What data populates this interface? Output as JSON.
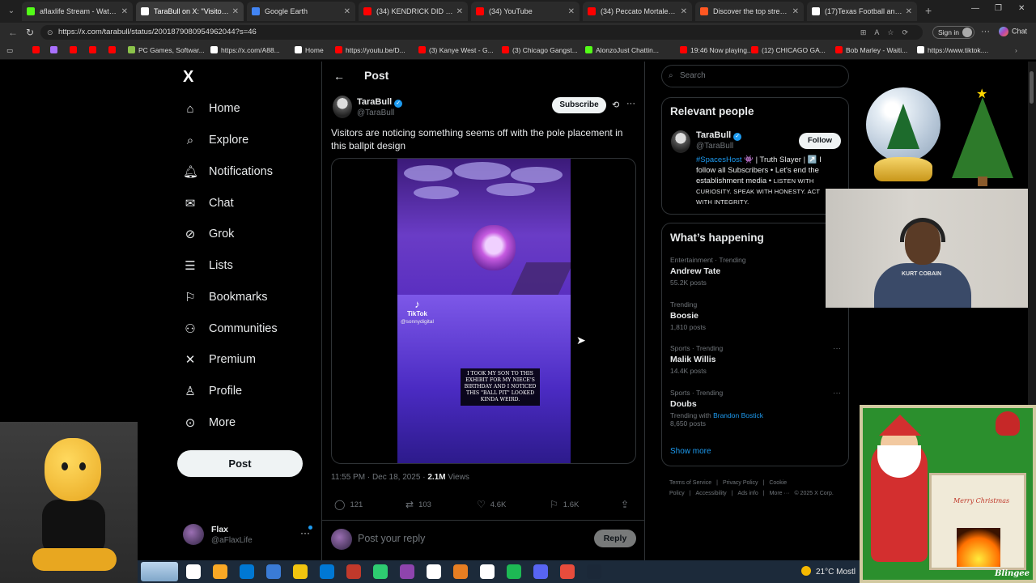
{
  "browser": {
    "tabs": [
      {
        "label": "aflaxlife Stream - Watch Live",
        "favicon_color": "#53fc18"
      },
      {
        "label": "TaraBull on X: \"Visitors are n",
        "favicon_color": "#ffffff"
      },
      {
        "label": "Google Earth",
        "favicon_color": "#4285f4"
      },
      {
        "label": "(34) KENDRICK DID IRREVER",
        "favicon_color": "#ff0000"
      },
      {
        "label": "(34) YouTube",
        "favicon_color": "#ff0000"
      },
      {
        "label": "(34) Peccato Mortale (Happi",
        "favicon_color": "#ff0000"
      },
      {
        "label": "Discover the top streamed m",
        "favicon_color": "#ff5722"
      },
      {
        "label": "(17)Texas Football and Quin",
        "favicon_color": "#ffffff"
      }
    ],
    "url": "https://x.com/tarabull/status/2001879080954962044?s=46",
    "signin_label": "Sign in",
    "chat_label": "Chat",
    "bookmarks": [
      {
        "label": "",
        "color": "#ff0000"
      },
      {
        "label": "",
        "color": "#a970ff"
      },
      {
        "label": "",
        "color": "#ff0000"
      },
      {
        "label": "",
        "color": "#ff0000"
      },
      {
        "label": "",
        "color": "#ff0000"
      },
      {
        "label": "PC Games, Softwar...",
        "color": "#8bc34a"
      },
      {
        "label": "https://x.com/A88...",
        "color": "#ffffff"
      },
      {
        "label": "Home",
        "color": "#ffffff"
      },
      {
        "label": "https://youtu.be/D...",
        "color": "#ff0000"
      },
      {
        "label": "(3) Kanye West - G...",
        "color": "#ff0000"
      },
      {
        "label": "(3) Chicago Gangst...",
        "color": "#ff0000"
      },
      {
        "label": "AlonzoJust Chattin...",
        "color": "#53fc18"
      },
      {
        "label": "19:46 Now playing...",
        "color": "#ff0000"
      },
      {
        "label": "(12) CHICAGO GA...",
        "color": "#ff0000"
      },
      {
        "label": "Bob Marley - Waiti...",
        "color": "#ff0000"
      },
      {
        "label": "https://www.tiktok....",
        "color": "#ffffff"
      }
    ]
  },
  "sidebar": {
    "logo": "X",
    "items": [
      {
        "label": "Home",
        "icon": "home-icon"
      },
      {
        "label": "Explore",
        "icon": "search-icon"
      },
      {
        "label": "Notifications",
        "icon": "bell-icon"
      },
      {
        "label": "Chat",
        "icon": "mail-icon"
      },
      {
        "label": "Grok",
        "icon": "grok-icon"
      },
      {
        "label": "Lists",
        "icon": "list-icon"
      },
      {
        "label": "Bookmarks",
        "icon": "bookmark-icon"
      },
      {
        "label": "Communities",
        "icon": "people-icon"
      },
      {
        "label": "Premium",
        "icon": "x-icon"
      },
      {
        "label": "Profile",
        "icon": "person-icon"
      },
      {
        "label": "More",
        "icon": "more-circle-icon"
      }
    ],
    "post_button": "Post",
    "account": {
      "name": "Flax",
      "handle": "@aFlaxLife"
    }
  },
  "main": {
    "header": "Post",
    "post": {
      "author": "TaraBull",
      "handle": "@TaraBull",
      "subscribe_label": "Subscribe",
      "text": "Visitors are noticing something seems off with the pole placement in this ballpit design",
      "video": {
        "tiktok_label": "TikTok",
        "tiktok_user": "@sonnydigital",
        "caption": "I took my son to this exhibit for my niece's birthday and I noticed this \"ball pit\" looked kinda weird."
      },
      "timestamp": "11:55 PM · Dec 18, 2025 · ",
      "views_count": "2.1M",
      "views_label": " Views",
      "replies": "121",
      "reposts": "103",
      "likes": "4.6K",
      "bookmarks": "1.6K"
    },
    "reply_placeholder": "Post your reply",
    "reply_button": "Reply"
  },
  "right": {
    "search_placeholder": "Search",
    "relevant_title": "Relevant people",
    "relevant_person": {
      "name": "TaraBull",
      "handle": "@TaraBull",
      "follow_label": "Follow",
      "bio_tag": "#SpacesHost",
      "bio_text": " 👾 | Truth Slayer | ↗️ I follow all Subscribers • Let's end the establishment media • ",
      "bio_small": "LISTEN WITH CURIOSITY. SPEAK WITH HONESTY. ACT WITH INTEGRITY."
    },
    "happening_title": "What’s happening",
    "trends": [
      {
        "category": "Entertainment · Trending",
        "name": "Andrew Tate",
        "posts": "55.2K posts"
      },
      {
        "category": "Trending",
        "name": "Boosie",
        "posts": "1,810 posts"
      },
      {
        "category": "Sports · Trending",
        "name": "Malik Willis",
        "posts": "14.4K posts"
      },
      {
        "category": "Sports · Trending",
        "name": "Doubs",
        "posts_prefix": "Trending with ",
        "posts_link": "Brandon Bostick",
        "posts": "8,650 posts"
      }
    ],
    "show_more": "Show more",
    "footer": [
      "Terms of Service",
      "|",
      "Privacy Policy",
      "|",
      "Cookie Policy",
      "|",
      "Accessibility",
      "|",
      "Ads info",
      "|",
      "More ···",
      "© 2025 X Corp."
    ]
  },
  "overlays": {
    "webcam_shirt_text": "KURT COBAIN",
    "santa_text": "Merry Christmas",
    "blingee_text": "Blingee"
  },
  "taskbar": {
    "weather": "21°C  Mostl",
    "icon_colors": [
      "#ffffff",
      "#f9a825",
      "#0078d4",
      "#3a7bd5",
      "#f1c40f",
      "#0078d4",
      "#c0392b",
      "#2ecc71",
      "#8e44ad",
      "#ffffff",
      "#e67e22",
      "#ffffff",
      "#1db954",
      "#5865f2",
      "#e74c3c",
      "#1b2838"
    ]
  }
}
